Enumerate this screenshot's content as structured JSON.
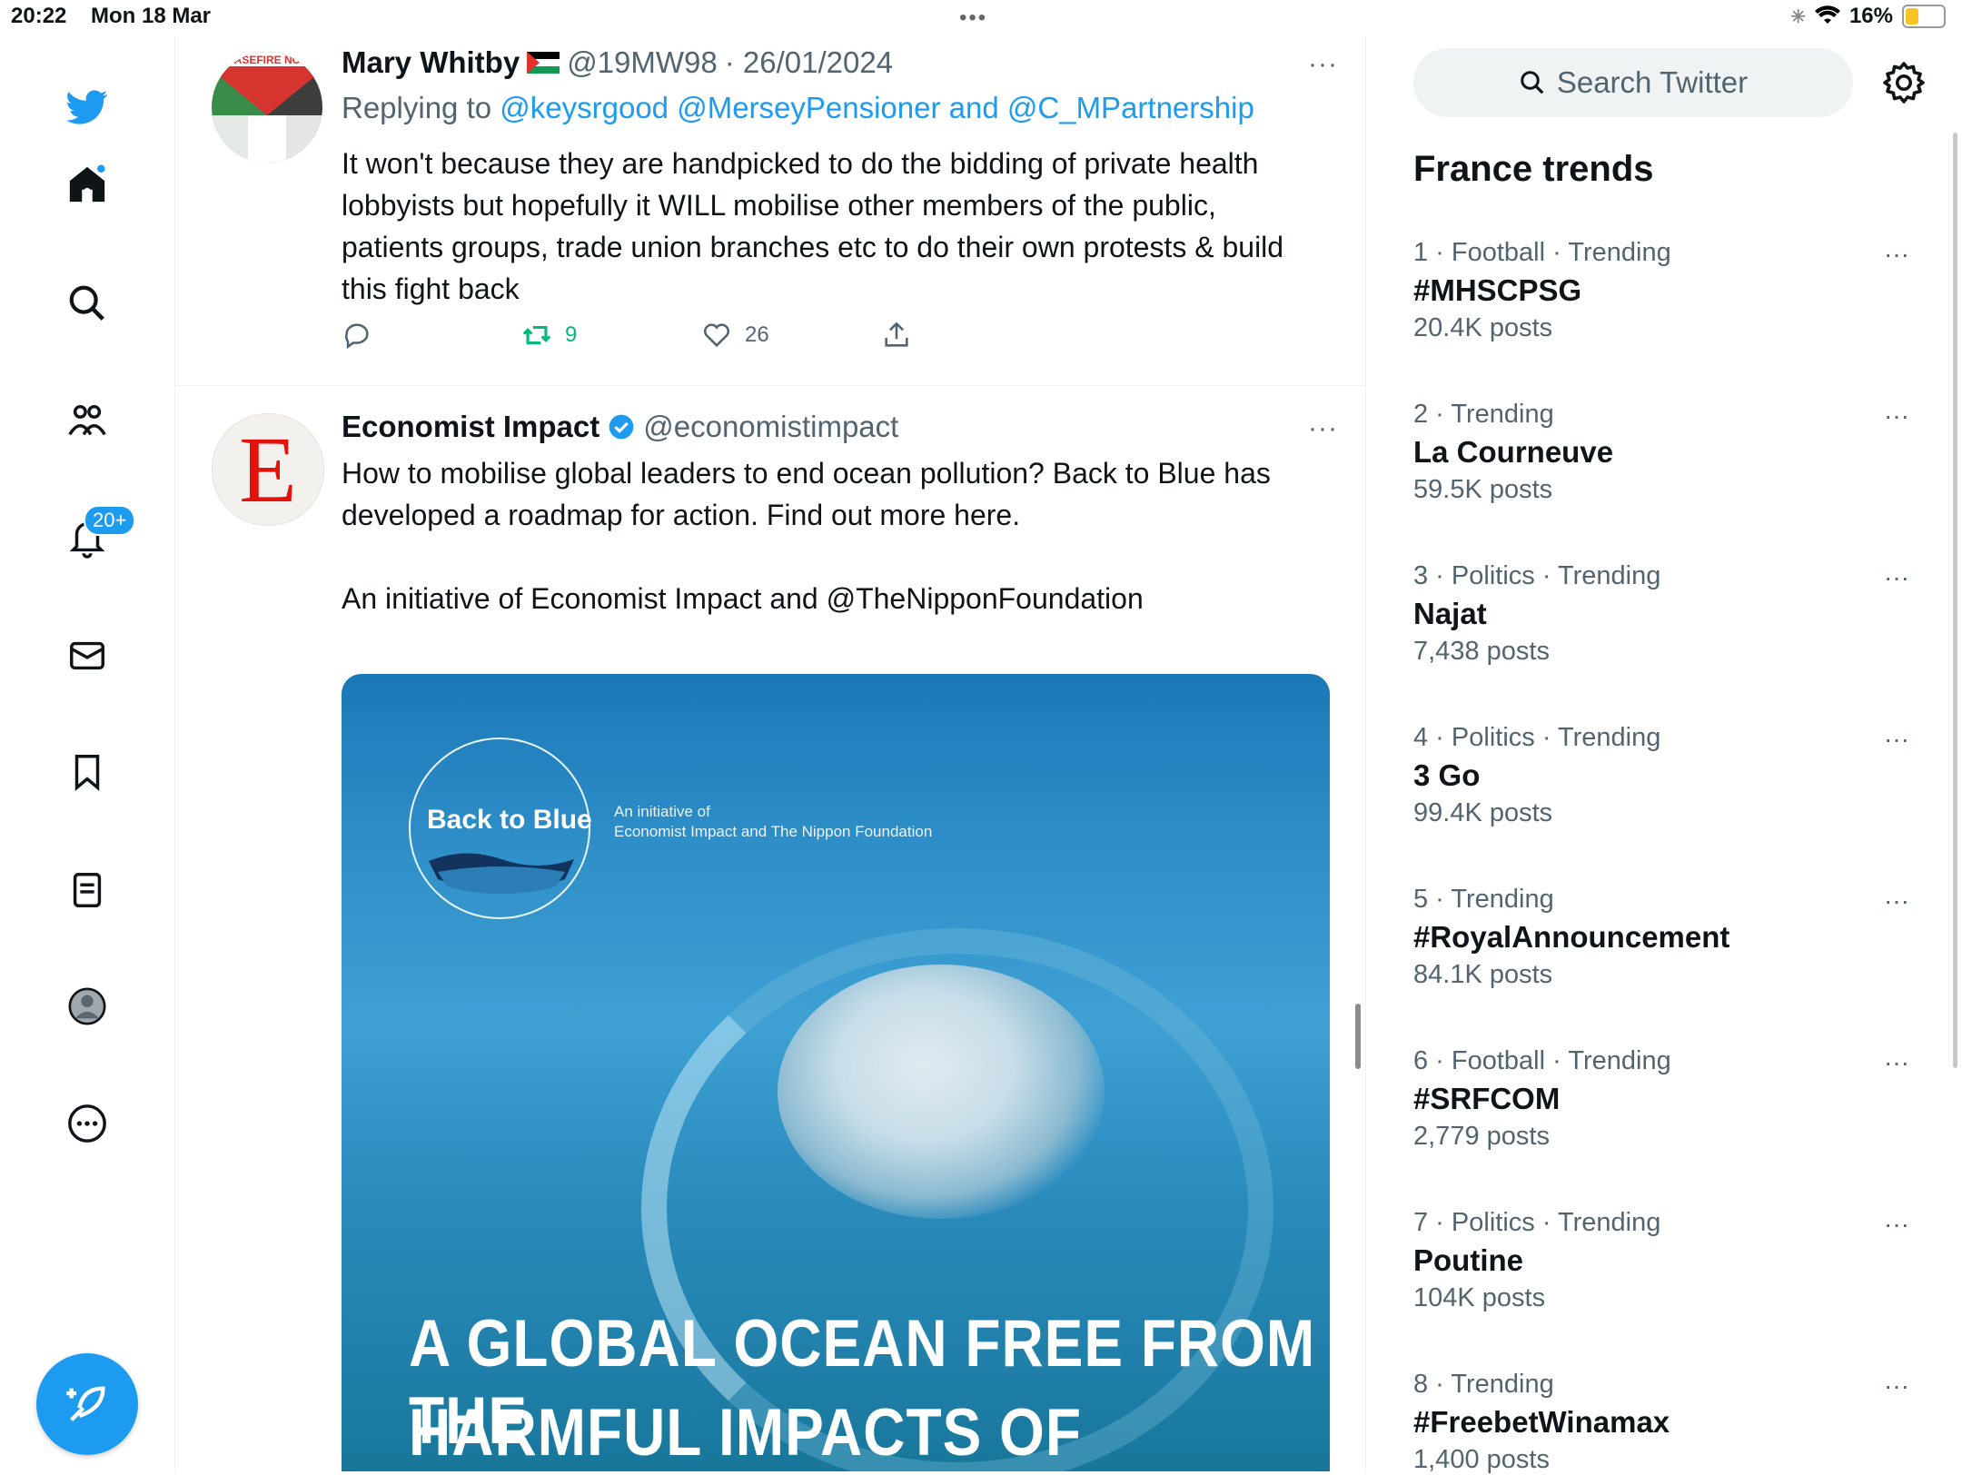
{
  "status_bar": {
    "time": "20:22",
    "date": "Mon 18 Mar",
    "dots": "•••",
    "battery": "16%"
  },
  "nav": {
    "notifications_badge": "20+"
  },
  "tweets": [
    {
      "name": "Mary Whitby",
      "handle": "@19MW98",
      "date": "· 26/01/2024",
      "avatar_text": "ASEFIRE NC",
      "replying_prefix": "Replying to",
      "replying_to": "@keysrgood @MerseyPensioner and @C_MPartnership",
      "text": "It won't  because they are handpicked to do the bidding of private health lobbyists but hopefully it WILL mobilise other members of the public, patients groups, trade union branches etc to do their own protests & build this fight back",
      "retweets": "9",
      "likes": "26"
    },
    {
      "name": "Economist Impact",
      "handle": "@economistimpact",
      "avatar_letter": "E",
      "text": "How to mobilise global leaders to end ocean pollution? Back to Blue has developed a roadmap for action. Find out more here.\n\nAn initiative of Economist Impact and @TheNipponFoundation",
      "media": {
        "logo": "Back to Blue",
        "subline1": "An initiative of",
        "subline2": "Economist Impact and The Nippon Foundation",
        "headline1": "A GLOBAL OCEAN FREE FROM THE",
        "headline2": "HARMFUL IMPACTS OF POLLUTION"
      }
    }
  ],
  "sidebar": {
    "search_placeholder": "Search Twitter",
    "trends_title": "France trends",
    "trends": [
      {
        "meta": "1 · Football · Trending",
        "name": "#MHSCPSG",
        "count": "20.4K posts"
      },
      {
        "meta": "2 · Trending",
        "name": "La Courneuve",
        "count": "59.5K posts"
      },
      {
        "meta": "3 · Politics · Trending",
        "name": "Najat",
        "count": "7,438 posts"
      },
      {
        "meta": "4 · Politics · Trending",
        "name": "3 Go",
        "count": "99.4K posts"
      },
      {
        "meta": "5 · Trending",
        "name": "#RoyalAnnouncement",
        "count": "84.1K posts"
      },
      {
        "meta": "6 · Football · Trending",
        "name": "#SRFCOM",
        "count": "2,779 posts"
      },
      {
        "meta": "7 · Politics · Trending",
        "name": "Poutine",
        "count": "104K posts"
      },
      {
        "meta": "8 · Trending",
        "name": "#FreebetWinamax",
        "count": "1,400 posts"
      }
    ],
    "more_label": "···"
  },
  "colors": {
    "accent": "#1d9bf0",
    "retweet": "#00ba7c",
    "muted": "#536471"
  }
}
